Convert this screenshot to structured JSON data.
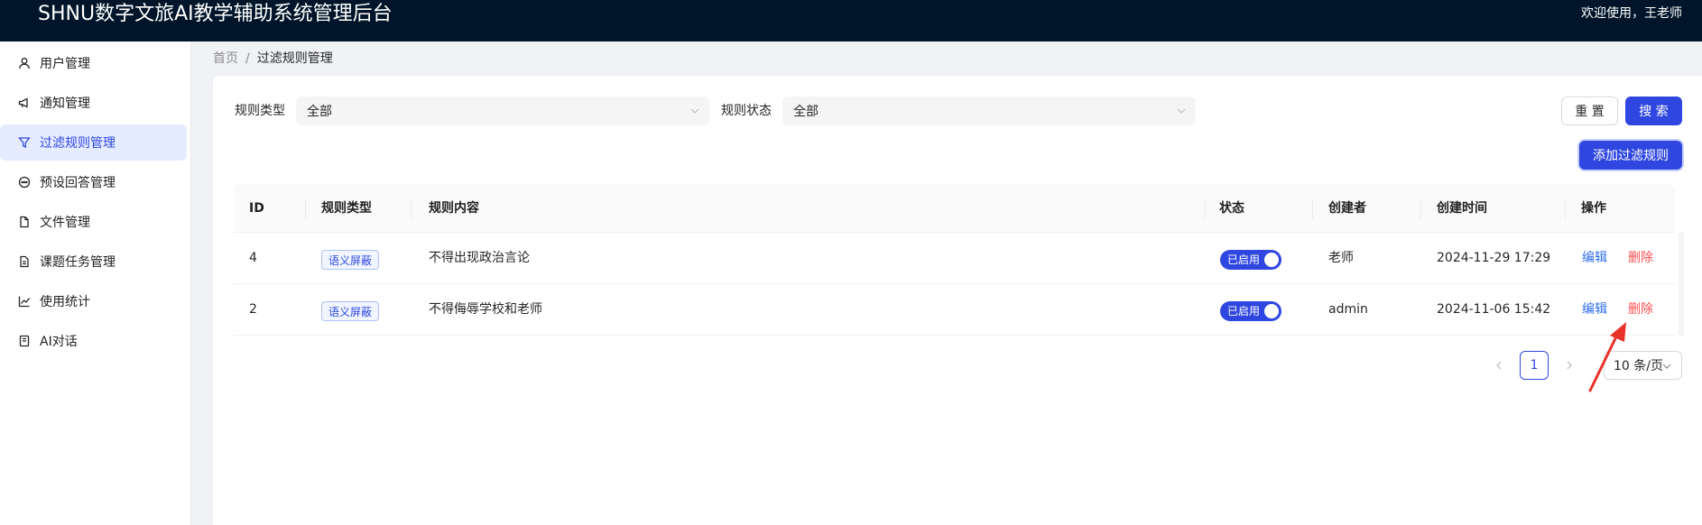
{
  "header": {
    "title": "SHNU数字文旅AI教学辅助系统管理后台",
    "welcome": "欢迎使用，王老师"
  },
  "sidebar": {
    "items": [
      {
        "label": "用户管理",
        "icon": "user-icon",
        "active": false
      },
      {
        "label": "通知管理",
        "icon": "megaphone-icon",
        "active": false
      },
      {
        "label": "过滤规则管理",
        "icon": "filter-icon",
        "active": true
      },
      {
        "label": "预设回答管理",
        "icon": "message-icon",
        "active": false
      },
      {
        "label": "文件管理",
        "icon": "file-icon",
        "active": false
      },
      {
        "label": "课题任务管理",
        "icon": "file-text-icon",
        "active": false
      },
      {
        "label": "使用统计",
        "icon": "line-chart-icon",
        "active": false
      },
      {
        "label": "AI对话",
        "icon": "book-icon",
        "active": false
      }
    ]
  },
  "breadcrumb": {
    "home": "首页",
    "separator": "/",
    "current": "过滤规则管理"
  },
  "filters": {
    "rule_type_label": "规则类型",
    "rule_type_value": "全部",
    "rule_status_label": "规则状态",
    "rule_status_value": "全部",
    "reset_label": "重 置",
    "search_label": "搜 索",
    "add_label": "添加过滤规则"
  },
  "table": {
    "columns": [
      "ID",
      "规则类型",
      "规则内容",
      "状态",
      "创建者",
      "创建时间",
      "操作"
    ],
    "rows": [
      {
        "id": "4",
        "type": "语义屏蔽",
        "content": "不得出现政治言论",
        "status": "已启用",
        "creator": "老师",
        "created_at": "2024-11-29 17:29",
        "edit": "编辑",
        "delete": "删除"
      },
      {
        "id": "2",
        "type": "语义屏蔽",
        "content": "不得侮辱学校和老师",
        "status": "已启用",
        "creator": "admin",
        "created_at": "2024-11-06 15:42",
        "edit": "编辑",
        "delete": "删除"
      }
    ]
  },
  "pagination": {
    "current_page": "1",
    "page_size": "10 条/页"
  },
  "colors": {
    "header_bg": "#001529",
    "primary": "#2f47e0",
    "danger": "#ff4d4f",
    "annotation": "#e8332a"
  }
}
